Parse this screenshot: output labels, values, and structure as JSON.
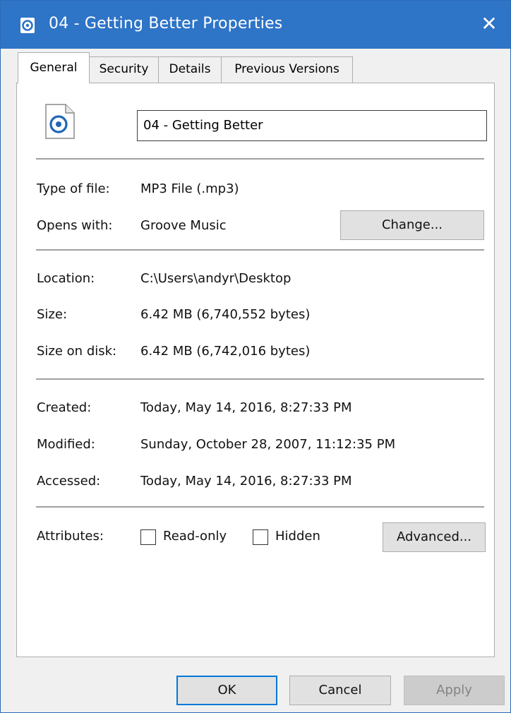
{
  "window": {
    "title": "04 - Getting Better Properties",
    "close_symbol": "✕",
    "accent_color": "#2e74c7"
  },
  "tabs": [
    {
      "label": "General",
      "active": true
    },
    {
      "label": "Security",
      "active": false
    },
    {
      "label": "Details",
      "active": false
    },
    {
      "label": "Previous Versions",
      "active": false
    }
  ],
  "file": {
    "icon": "groove-music-file-icon",
    "name": "04 - Getting Better"
  },
  "type_section": {
    "type_label": "Type of file:",
    "type_value": "MP3 File (.mp3)",
    "opens_label": "Opens with:",
    "opens_value": "Groove Music",
    "change_button": "Change..."
  },
  "location_section": {
    "location_label": "Location:",
    "location_value": "C:\\Users\\andyr\\Desktop",
    "size_label": "Size:",
    "size_value": "6.42 MB (6,740,552 bytes)",
    "size_on_disk_label": "Size on disk:",
    "size_on_disk_value": "6.42 MB (6,742,016 bytes)"
  },
  "dates_section": {
    "created_label": "Created:",
    "created_value": "Today, May 14, 2016, 8:27:33 PM",
    "modified_label": "Modified:",
    "modified_value": "Sunday, October 28, 2007, 11:12:35 PM",
    "accessed_label": "Accessed:",
    "accessed_value": "Today, May 14, 2016, 8:27:33 PM"
  },
  "attributes": {
    "label": "Attributes:",
    "read_only_label": "Read-only",
    "read_only_checked": false,
    "hidden_label": "Hidden",
    "hidden_checked": false,
    "advanced_button": "Advanced..."
  },
  "footer": {
    "ok_button": "OK",
    "cancel_button": "Cancel",
    "apply_button": "Apply",
    "apply_enabled": false
  }
}
